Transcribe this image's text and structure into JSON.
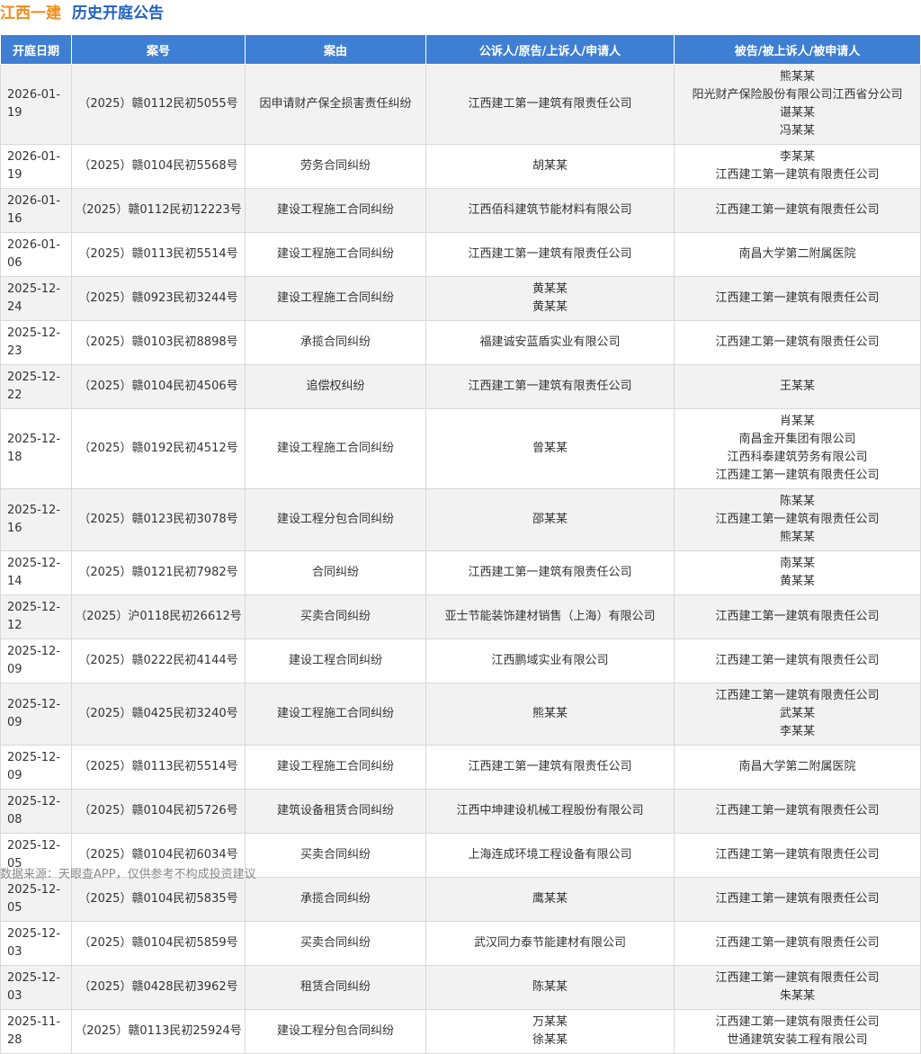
{
  "header": {
    "company": "江西一建",
    "subtitle": "历史开庭公告"
  },
  "table": {
    "columns": [
      "开庭日期",
      "案号",
      "案由",
      "公诉人/原告/上诉人/申请人",
      "被告/被上诉人/被申请人"
    ],
    "rows": [
      {
        "date": "2026-01-19",
        "case_no": "（2025）赣0112民初5055号",
        "cause": "因申请财产保全损害责任纠纷",
        "plaintiffs": [
          "江西建工第一建筑有限责任公司"
        ],
        "defendants": [
          "熊某某",
          "阳光财产保险股份有限公司江西省分公司",
          "谌某某",
          "冯某某"
        ]
      },
      {
        "date": "2026-01-19",
        "case_no": "（2025）赣0104民初5568号",
        "cause": "劳务合同纠纷",
        "plaintiffs": [
          "胡某某"
        ],
        "defendants": [
          "李某某",
          "江西建工第一建筑有限责任公司"
        ]
      },
      {
        "date": "2026-01-16",
        "case_no": "（2025）赣0112民初12223号",
        "cause": "建设工程施工合同纠纷",
        "plaintiffs": [
          "江西佰科建筑节能材料有限公司"
        ],
        "defendants": [
          "江西建工第一建筑有限责任公司"
        ]
      },
      {
        "date": "2026-01-06",
        "case_no": "（2025）赣0113民初5514号",
        "cause": "建设工程施工合同纠纷",
        "plaintiffs": [
          "江西建工第一建筑有限责任公司"
        ],
        "defendants": [
          "南昌大学第二附属医院"
        ]
      },
      {
        "date": "2025-12-24",
        "case_no": "（2025）赣0923民初3244号",
        "cause": "建设工程施工合同纠纷",
        "plaintiffs": [
          "黄某某",
          "黄某某"
        ],
        "defendants": [
          "江西建工第一建筑有限责任公司"
        ]
      },
      {
        "date": "2025-12-23",
        "case_no": "（2025）赣0103民初8898号",
        "cause": "承揽合同纠纷",
        "plaintiffs": [
          "福建诚安蓝盾实业有限公司"
        ],
        "defendants": [
          "江西建工第一建筑有限责任公司"
        ]
      },
      {
        "date": "2025-12-22",
        "case_no": "（2025）赣0104民初4506号",
        "cause": "追偿权纠纷",
        "plaintiffs": [
          "江西建工第一建筑有限责任公司"
        ],
        "defendants": [
          "王某某"
        ]
      },
      {
        "date": "2025-12-18",
        "case_no": "（2025）赣0192民初4512号",
        "cause": "建设工程施工合同纠纷",
        "plaintiffs": [
          "曾某某"
        ],
        "defendants": [
          "肖某某",
          "南昌金开集团有限公司",
          "江西科泰建筑劳务有限公司",
          "江西建工第一建筑有限责任公司"
        ]
      },
      {
        "date": "2025-12-16",
        "case_no": "（2025）赣0123民初3078号",
        "cause": "建设工程分包合同纠纷",
        "plaintiffs": [
          "邵某某"
        ],
        "defendants": [
          "陈某某",
          "江西建工第一建筑有限责任公司",
          "熊某某"
        ]
      },
      {
        "date": "2025-12-14",
        "case_no": "（2025）赣0121民初7982号",
        "cause": "合同纠纷",
        "plaintiffs": [
          "江西建工第一建筑有限责任公司"
        ],
        "defendants": [
          "南某某",
          "黄某某"
        ]
      },
      {
        "date": "2025-12-12",
        "case_no": "（2025）沪0118民初26612号",
        "cause": "买卖合同纠纷",
        "plaintiffs": [
          "亚士节能装饰建材销售（上海）有限公司"
        ],
        "defendants": [
          "江西建工第一建筑有限责任公司"
        ]
      },
      {
        "date": "2025-12-09",
        "case_no": "（2025）赣0222民初4144号",
        "cause": "建设工程合同纠纷",
        "plaintiffs": [
          "江西鹏域实业有限公司"
        ],
        "defendants": [
          "江西建工第一建筑有限责任公司"
        ]
      },
      {
        "date": "2025-12-09",
        "case_no": "（2025）赣0425民初3240号",
        "cause": "建设工程施工合同纠纷",
        "plaintiffs": [
          "熊某某"
        ],
        "defendants": [
          "江西建工第一建筑有限责任公司",
          "武某某",
          "李某某"
        ]
      },
      {
        "date": "2025-12-09",
        "case_no": "（2025）赣0113民初5514号",
        "cause": "建设工程施工合同纠纷",
        "plaintiffs": [
          "江西建工第一建筑有限责任公司"
        ],
        "defendants": [
          "南昌大学第二附属医院"
        ]
      },
      {
        "date": "2025-12-08",
        "case_no": "（2025）赣0104民初5726号",
        "cause": "建筑设备租赁合同纠纷",
        "plaintiffs": [
          "江西中坤建设机械工程股份有限公司"
        ],
        "defendants": [
          "江西建工第一建筑有限责任公司"
        ]
      },
      {
        "date": "2025-12-05",
        "case_no": "（2025）赣0104民初6034号",
        "cause": "买卖合同纠纷",
        "plaintiffs": [
          "上海连成环境工程设备有限公司"
        ],
        "defendants": [
          "江西建工第一建筑有限责任公司"
        ]
      },
      {
        "date": "2025-12-05",
        "case_no": "（2025）赣0104民初5835号",
        "cause": "承揽合同纠纷",
        "plaintiffs": [
          "鹰某某"
        ],
        "defendants": [
          "江西建工第一建筑有限责任公司"
        ]
      },
      {
        "date": "2025-12-03",
        "case_no": "（2025）赣0104民初5859号",
        "cause": "买卖合同纠纷",
        "plaintiffs": [
          "武汉同力泰节能建材有限公司"
        ],
        "defendants": [
          "江西建工第一建筑有限责任公司"
        ]
      },
      {
        "date": "2025-12-03",
        "case_no": "（2025）赣0428民初3962号",
        "cause": "租赁合同纠纷",
        "plaintiffs": [
          "陈某某"
        ],
        "defendants": [
          "江西建工第一建筑有限责任公司",
          "朱某某"
        ]
      },
      {
        "date": "2025-11-28",
        "case_no": "（2025）赣0113民初25924号",
        "cause": "建设工程分包合同纠纷",
        "plaintiffs": [
          "万某某",
          "徐某某"
        ],
        "defendants": [
          "江西建工第一建筑有限责任公司",
          "世通建筑安装工程有限公司"
        ]
      }
    ]
  },
  "footer": {
    "source": "数据来源：天眼查APP，仅供参考不构成投资建议"
  }
}
